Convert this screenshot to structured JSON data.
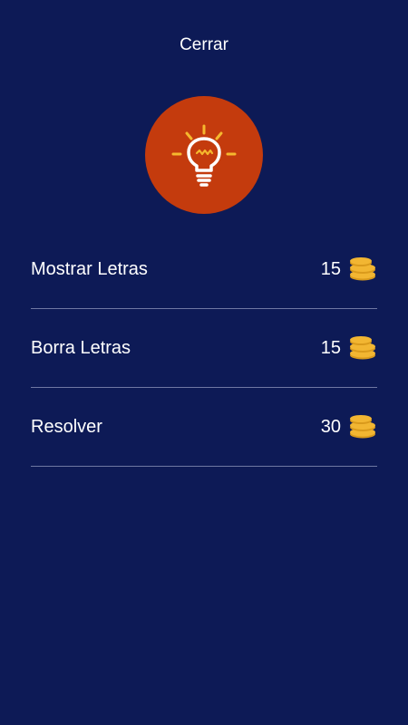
{
  "header": {
    "close_label": "Cerrar"
  },
  "hint": {
    "icon": "lightbulb-icon",
    "circle_color": "#c43b0d",
    "icon_color": "#f5b82e"
  },
  "options": [
    {
      "label": "Mostrar Letras",
      "price": "15",
      "icon": "coins-icon"
    },
    {
      "label": "Borra Letras",
      "price": "15",
      "icon": "coins-icon"
    },
    {
      "label": "Resolver",
      "price": "30",
      "icon": "coins-icon"
    }
  ],
  "colors": {
    "background": "#0d1a56",
    "coin": "#f2b632",
    "divider": "#6f78a3"
  }
}
